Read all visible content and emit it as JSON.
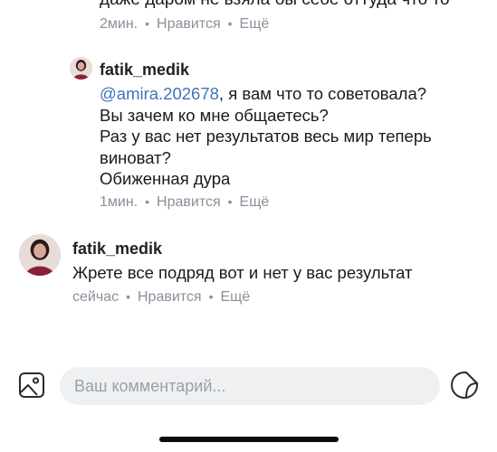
{
  "top_comment": {
    "partial_text": "даже даром не взяла бы себе оттуда что то",
    "time": "2мин.",
    "like_label": "Нравится",
    "more_label": "Ещё"
  },
  "reply": {
    "username": "fatik_medik",
    "mention": "@amira.202678",
    "lines": [
      ", я вам что то советовала?",
      "Вы зачем ко мне общаетесь?",
      "Раз у вас нет результатов весь мир теперь",
      "виноват?",
      "Обиженная дура"
    ],
    "time": "1мин.",
    "like_label": "Нравится",
    "more_label": "Ещё"
  },
  "comment": {
    "username": "fatik_medik",
    "text": "Жрете все подряд вот и нет у вас результат",
    "time": "сейчас",
    "like_label": "Нравится",
    "more_label": "Ещё"
  },
  "composer": {
    "placeholder": "Ваш комментарий..."
  },
  "icons": {
    "image": "image-icon",
    "sticker": "sticker-icon",
    "separator": "•"
  },
  "colors": {
    "mention": "#3f74b8",
    "meta": "#8a8f99",
    "input_background": "#eef0f2"
  }
}
